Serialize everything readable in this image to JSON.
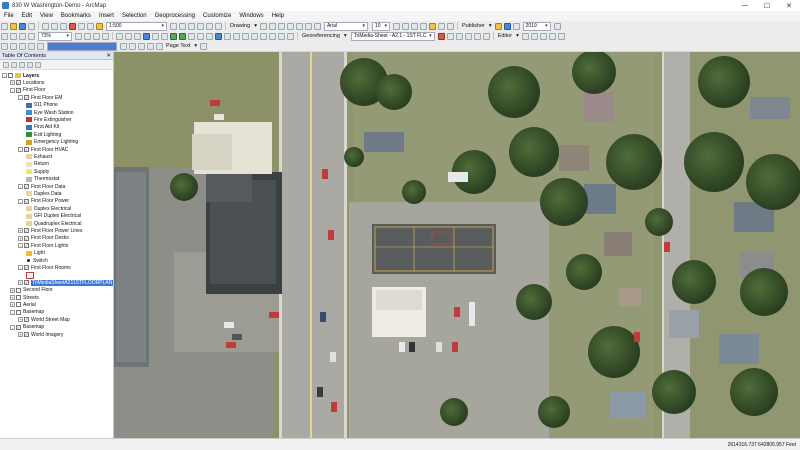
{
  "window": {
    "title": "830 W Washington-Demo - ArcMap",
    "minimize": "—",
    "maximize": "☐",
    "close": "✕"
  },
  "menu": [
    "File",
    "Edit",
    "View",
    "Bookmarks",
    "Insert",
    "Selection",
    "Geoprocessing",
    "Customize",
    "Windows",
    "Help"
  ],
  "toolbar": {
    "scale": "1:500",
    "drawing_label": "Drawing",
    "font_name": "Arial",
    "font_size": "10",
    "publisher_label": "Publisher",
    "year_value": "2019",
    "zoom_percent": "73%",
    "georeferencing_label": "Georeferencing",
    "georef_layer": "TriMedia-Sheet - A2.1 - 1ST FLC",
    "editor_label": "Editor",
    "page_text_label": "Page Text"
  },
  "toc": {
    "title": "Table Of Contents",
    "close": "✕",
    "rows": [
      {
        "text": "Layers",
        "level": 0,
        "exp": "-",
        "chk": false,
        "sym": "layers",
        "bold": true
      },
      {
        "text": "Locations",
        "level": 1,
        "exp": "+",
        "chk": true
      },
      {
        "text": "First Floor",
        "level": 1,
        "exp": "-",
        "chk": true
      },
      {
        "text": "First Floor EM",
        "level": 2,
        "exp": "-",
        "chk": true
      },
      {
        "text": "911 Phone",
        "level": 3,
        "sym": "phone"
      },
      {
        "text": "Eye Wash Station",
        "level": 3,
        "sym": "eye"
      },
      {
        "text": "Fire Extinguisher",
        "level": 3,
        "sym": "fire"
      },
      {
        "text": "First Aid Kit",
        "level": 3,
        "sym": "aid"
      },
      {
        "text": "Exit Lighting",
        "level": 3,
        "sym": "exit"
      },
      {
        "text": "Emergency Lighting",
        "level": 3,
        "sym": "emlight"
      },
      {
        "text": "First Floor HVAC",
        "level": 2,
        "exp": "-",
        "chk": true
      },
      {
        "text": "Exhaust",
        "level": 3,
        "sym": "fill-tan"
      },
      {
        "text": "Return",
        "level": 3,
        "sym": "fill-tan2"
      },
      {
        "text": "Supply",
        "level": 3,
        "sym": "fill-yellow"
      },
      {
        "text": "Thermostat",
        "level": 3,
        "sym": "thermo"
      },
      {
        "text": "First Floor Data",
        "level": 2,
        "exp": "-",
        "chk": true
      },
      {
        "text": "Duplex Data",
        "level": 3,
        "sym": "fill-tan"
      },
      {
        "text": "First Floor Power",
        "level": 2,
        "exp": "-",
        "chk": true
      },
      {
        "text": "Duplex Electrical",
        "level": 3,
        "sym": "fill-tan"
      },
      {
        "text": "GFI Duplex Electrical",
        "level": 3,
        "sym": "fill-tan"
      },
      {
        "text": "Quadruplex Electrical",
        "level": 3,
        "sym": "fill-tan"
      },
      {
        "text": "First Floor Power Lines",
        "level": 2,
        "exp": "+",
        "chk": true
      },
      {
        "text": "First Floor Desks",
        "level": 2,
        "exp": "+",
        "chk": true
      },
      {
        "text": "First Floor Lights",
        "level": 2,
        "exp": "-",
        "chk": true
      },
      {
        "text": "Light",
        "level": 3,
        "sym": "bulb"
      },
      {
        "text": "Switch",
        "level": 3,
        "sym": "dot"
      },
      {
        "text": "First Floor Rooms",
        "level": 2,
        "exp": "-",
        "chk": true
      },
      {
        "text": "",
        "level": 3,
        "sym": "fill-red-outline"
      },
      {
        "text": "TriMediaSheetA211STFLOORPLAN",
        "level": 2,
        "exp": "+",
        "chk": true,
        "selected": true
      },
      {
        "text": "Second Floor",
        "level": 1,
        "exp": "+",
        "chk": false
      },
      {
        "text": "Streets",
        "level": 1,
        "exp": "+",
        "chk": false
      },
      {
        "text": "Aerial",
        "level": 1,
        "exp": "+",
        "chk": false
      },
      {
        "text": "Basemap",
        "level": 1,
        "exp": "-",
        "chk": false
      },
      {
        "text": "World Street Map",
        "level": 2,
        "exp": "+",
        "chk": true
      },
      {
        "text": "Basemap",
        "level": 1,
        "exp": "-",
        "chk": true
      },
      {
        "text": "World Imagery",
        "level": 2,
        "exp": "+",
        "chk": true
      }
    ]
  },
  "status": {
    "coords": "2614316.737  642805.957 Feet"
  }
}
